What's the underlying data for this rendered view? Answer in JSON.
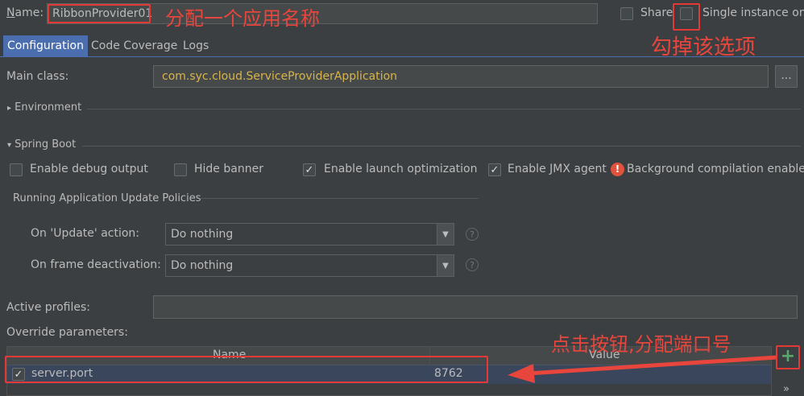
{
  "header": {
    "name_label": "Name:",
    "name_value": "RibbonProvider01",
    "share_label": "Share",
    "single_instance_label": "Single instance only"
  },
  "tabs": [
    {
      "label": "Configuration",
      "active": true
    },
    {
      "label": "Code Coverage",
      "active": false
    },
    {
      "label": "Logs",
      "active": false
    }
  ],
  "main_class": {
    "label": "Main class:",
    "value": "com.syc.cloud.ServiceProviderApplication",
    "browse_label": "..."
  },
  "environment": {
    "label": "Environment",
    "arrow": "▸"
  },
  "spring_boot": {
    "label": "Spring Boot",
    "arrow": "▾",
    "options": [
      {
        "label": "Enable debug output",
        "checked": false
      },
      {
        "label": "Hide banner",
        "checked": false
      },
      {
        "label": "Enable launch optimization",
        "checked": true
      },
      {
        "label": "Enable JMX agent",
        "checked": true
      }
    ],
    "warning_text": "Background compilation enabled",
    "policies_label": "Running Application Update Policies",
    "update_action": {
      "label": "On 'Update' action:",
      "value": "Do nothing"
    },
    "frame_deactivation": {
      "label": "On frame deactivation:",
      "value": "Do nothing"
    }
  },
  "active_profiles": {
    "label": "Active profiles:",
    "value": ""
  },
  "override": {
    "label": "Override parameters:",
    "columns": [
      "Name",
      "Value"
    ],
    "rows": [
      {
        "checked": true,
        "name": "server.port",
        "value": "8762"
      }
    ],
    "add_label": "+",
    "more_label": "»"
  },
  "annotations": {
    "name_note": "分配一个应用名称",
    "uncheck_note": "勾掉该选项",
    "add_note": "点击按钮,分配端口号"
  },
  "colors": {
    "background": "#3c3f41",
    "accent_tab": "#4b6eaf",
    "main_class_text": "#d9b44a",
    "annotation": "#e8453c",
    "add_green": "#59a869",
    "warning": "#e0533c"
  }
}
